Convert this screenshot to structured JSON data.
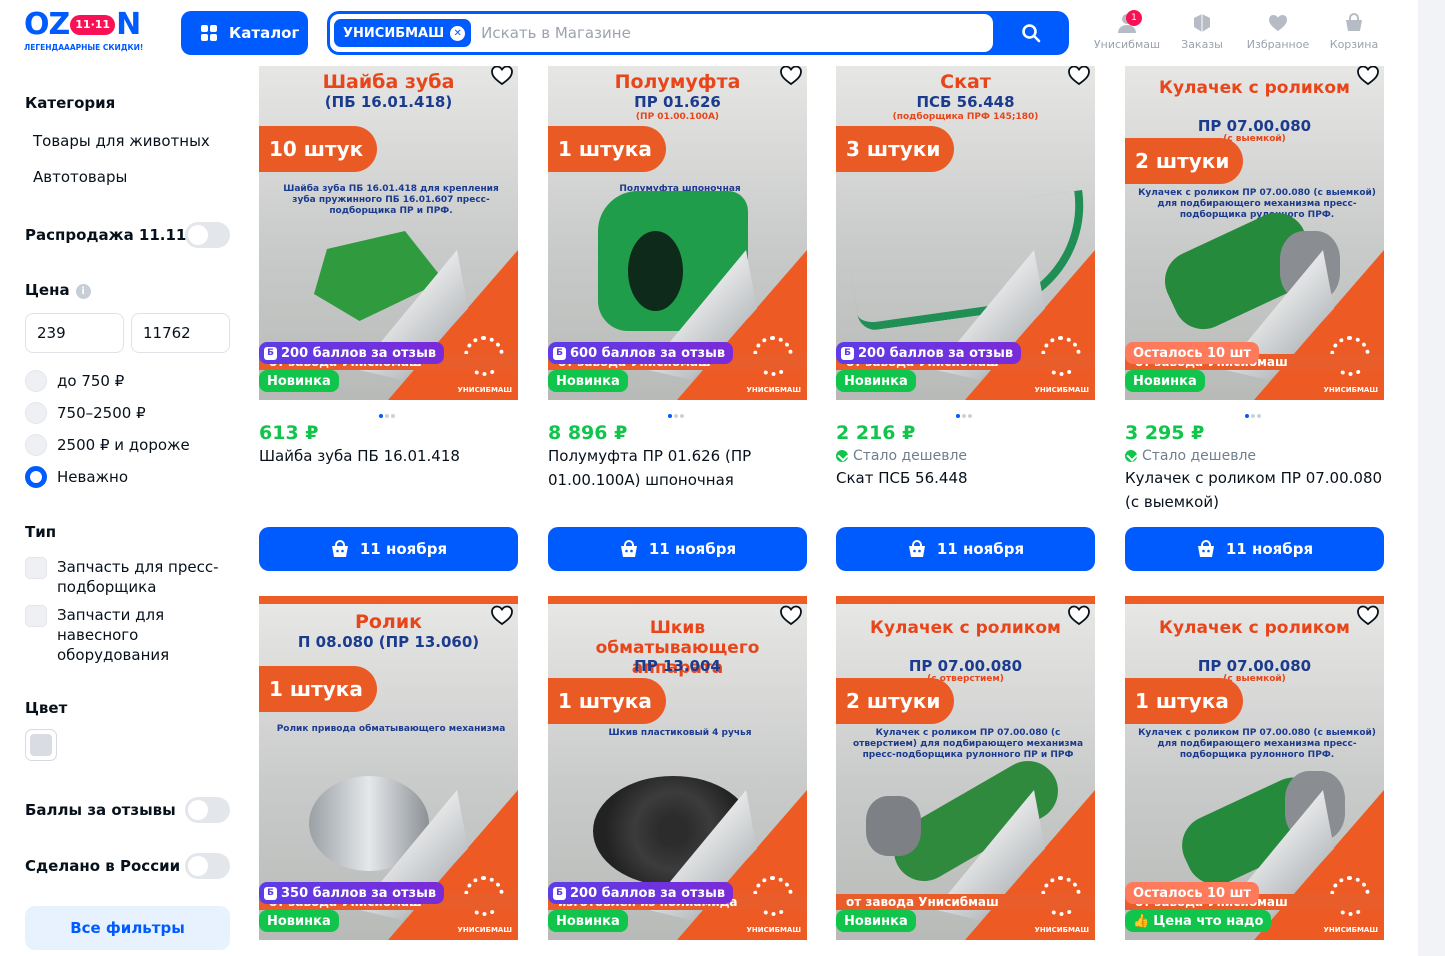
{
  "header": {
    "logo_text": "OZON",
    "logo_badge": "11·11",
    "logo_tagline": "ЛЕГЕНДАААРНЫЕ СКИДКИ!",
    "catalog_label": "Каталог",
    "search_chip": "УНИСИБМАШ",
    "search_placeholder": "Искать в Магазине",
    "nav": [
      {
        "label": "Унисибмаш",
        "icon": "user-icon",
        "badge": "1"
      },
      {
        "label": "Заказы",
        "icon": "box-icon"
      },
      {
        "label": "Избранное",
        "icon": "heart-icon"
      },
      {
        "label": "Корзина",
        "icon": "cart-icon"
      }
    ]
  },
  "sidebar": {
    "category_title": "Категория",
    "categories": [
      "Товары для животных",
      "Автотовары"
    ],
    "sale_label": "Распродажа 11.11",
    "price_title": "Цена",
    "price_from": "239",
    "price_to": "11762",
    "price_options": [
      "до 750 ₽",
      "750–2500 ₽",
      "2500 ₽ и дороже",
      "Неважно"
    ],
    "price_selected": "Неважно",
    "type_title": "Тип",
    "types": [
      "Запчасть для пресс-подборщика",
      "Запчасти для навесного оборудования"
    ],
    "color_title": "Цвет",
    "reviews_points_label": "Баллы за отзывы",
    "made_in_russia_label": "Сделано в России",
    "all_filters_label": "Все фильтры"
  },
  "products": [
    {
      "img_title": "Шайба зуба",
      "img_code": "(ПБ 16.01.418)",
      "img_sub": "",
      "img_qty": "10 штук",
      "img_desc": "Шайба зуба ПБ 16.01.418 для крепления зуба пружинного ПБ 16.01.607 пресс-подборщика ПР и ПРФ.",
      "points": "200 баллов за отзыв",
      "left": "",
      "strip": "от завода Унисибмаш",
      "badge_new": "Новинка",
      "price": "613 ₽",
      "cheaper": "",
      "name": "Шайба зуба ПБ 16.01.418",
      "button": "11 ноября",
      "brand": "УНИСИБМАШ"
    },
    {
      "img_title": "Полумуфта",
      "img_code": "ПР 01.626",
      "img_sub": "(ПР 01.00.100А)",
      "img_qty": "1 штука",
      "img_desc": "Полумуфта шпоночная",
      "points": "600 баллов за отзыв",
      "left": "",
      "strip": "от завода Унисибмаш",
      "badge_new": "Новинка",
      "price": "8 896 ₽",
      "cheaper": "",
      "name": "Полумуфта ПР 01.626 (ПР 01.00.100А) шпоночная",
      "button": "11 ноября",
      "brand": "УНИСИБМАШ"
    },
    {
      "img_title": "Скат",
      "img_code": "ПСБ 56.448",
      "img_sub": "(подборщика ПРФ 145;180)",
      "img_qty": "3 штуки",
      "img_desc": "",
      "points": "200 баллов за отзыв",
      "left": "",
      "strip": "от завода Унисибмаш",
      "badge_new": "Новинка",
      "price": "2 216 ₽",
      "cheaper": "Стало дешевле",
      "name": "Скат ПСБ 56.448",
      "button": "11 ноября",
      "brand": "УНИСИБМАШ"
    },
    {
      "img_title": "Кулачек с роликом",
      "img_code": "ПР 07.00.080",
      "img_sub": "(с выемкой)",
      "img_qty": "2 штуки",
      "img_desc": "Кулачек с роликом ПР 07.00.080 (с выемкой) для подбирающего механизма пресс-подборщика рулонного ПРФ.",
      "points": "",
      "left": "Осталось 10 шт",
      "strip": "от завода Унисибмаш",
      "badge_new": "Новинка",
      "price": "3 295 ₽",
      "cheaper": "Стало дешевле",
      "name": "Кулачек с роликом ПР 07.00.080 (с выемкой)",
      "button": "11 ноября",
      "brand": "УНИСИБМАШ"
    },
    {
      "img_title": "Ролик",
      "img_code": "П 08.080 (ПР 13.060)",
      "img_sub": "",
      "img_qty": "1 штука",
      "img_desc": "Ролик привода обматывающего механизма",
      "points": "350 баллов за отзыв",
      "left": "",
      "strip": "от завода Унисибмаш",
      "badge_new": "Новинка",
      "price": "",
      "cheaper": "",
      "name": "",
      "button": "",
      "brand": "УНИСИБМАШ"
    },
    {
      "img_title": "Шкив обматывающего аппарата",
      "img_code": "ПР 13.004",
      "img_sub": "",
      "img_qty": "1 штука",
      "img_desc": "Шкив пластиковый 4 ручья",
      "points": "200 баллов за отзыв",
      "left": "",
      "strip": "изготовлен из полиамида",
      "badge_new": "Новинка",
      "price": "",
      "cheaper": "",
      "name": "",
      "button": "",
      "brand": "УНИСИБМАШ"
    },
    {
      "img_title": "Кулачек с роликом",
      "img_code": "ПР 07.00.080",
      "img_sub": "(с отверстием)",
      "img_qty": "2 штуки",
      "img_desc": "Кулачек с роликом ПР 07.00.080 (с отверстием) для подбирающего механизма пресс-подборщика рулонного ПР и ПРФ",
      "points": "",
      "left": "",
      "strip": "от завода Унисибмаш",
      "badge_new": "Новинка",
      "price": "",
      "cheaper": "",
      "name": "",
      "button": "",
      "brand": "УНИСИБМАШ"
    },
    {
      "img_title": "Кулачек с роликом",
      "img_code": "ПР 07.00.080",
      "img_sub": "(с выемкой)",
      "img_qty": "1 штука",
      "img_desc": "Кулачек с роликом ПР 07.00.080 (с выемкой) для подбирающего механизма пресс-подборщика рулонного ПРФ.",
      "points": "",
      "left": "Осталось 10 шт",
      "strip": "от завода Унисибмаш",
      "badge_new": "Цена что надо",
      "price": "",
      "cheaper": "",
      "name": "",
      "button": "",
      "brand": "УНИСИБМАШ"
    }
  ]
}
